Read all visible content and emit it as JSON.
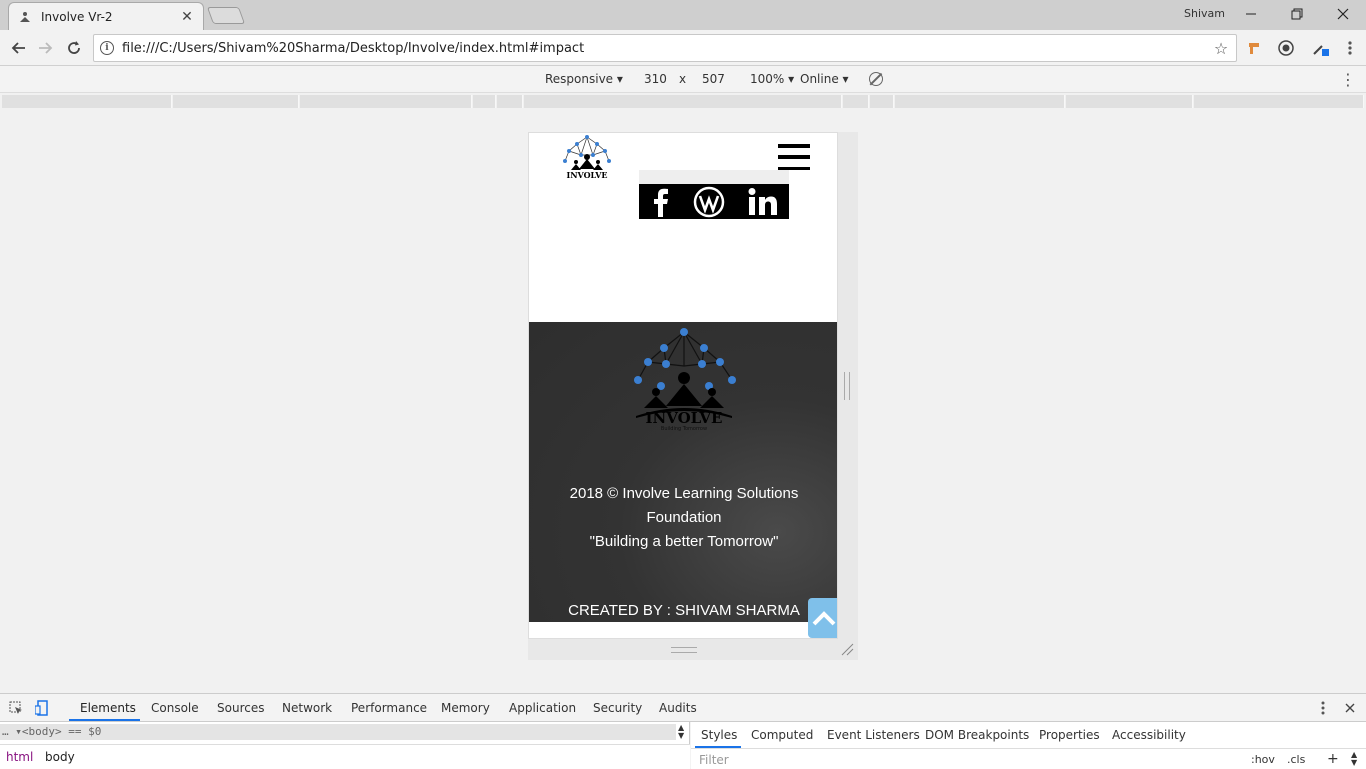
{
  "browser": {
    "tab_title": "Involve Vr-2",
    "tab_close": "✕",
    "profile_name": "Shivam",
    "url": "file:///C:/Users/Shivam%20Sharma/Desktop/Involve/index.html#impact"
  },
  "device_toolbar": {
    "device": "Responsive",
    "width": "310",
    "times": "x",
    "height": "507",
    "zoom": "100%",
    "network": "Online"
  },
  "site": {
    "logo_text": "INVOLVE",
    "logo_tagline": "Building Tomorrow",
    "footer_line1": "2018 © Involve Learning Solutions",
    "footer_line2": "Foundation",
    "footer_line3": "\"Building a better Tomorrow\"",
    "credit": "CREATED BY : SHIVAM SHARMA"
  },
  "devtools": {
    "tabs": [
      "Elements",
      "Console",
      "Sources",
      "Network",
      "Performance",
      "Memory",
      "Application",
      "Security",
      "Audits"
    ],
    "dom_line": "… ▾<body> == $0",
    "breadcrumbs": [
      "html",
      "body"
    ],
    "side_tabs": [
      "Styles",
      "Computed",
      "Event Listeners",
      "DOM Breakpoints",
      "Properties",
      "Accessibility"
    ],
    "filter_placeholder": "Filter",
    "hov": ":hov",
    "cls": ".cls",
    "plus": "+"
  },
  "colors": {
    "accent": "#1a73e8",
    "to_top": "#7fc0ea",
    "logo_blue": "#3b7fd1"
  }
}
